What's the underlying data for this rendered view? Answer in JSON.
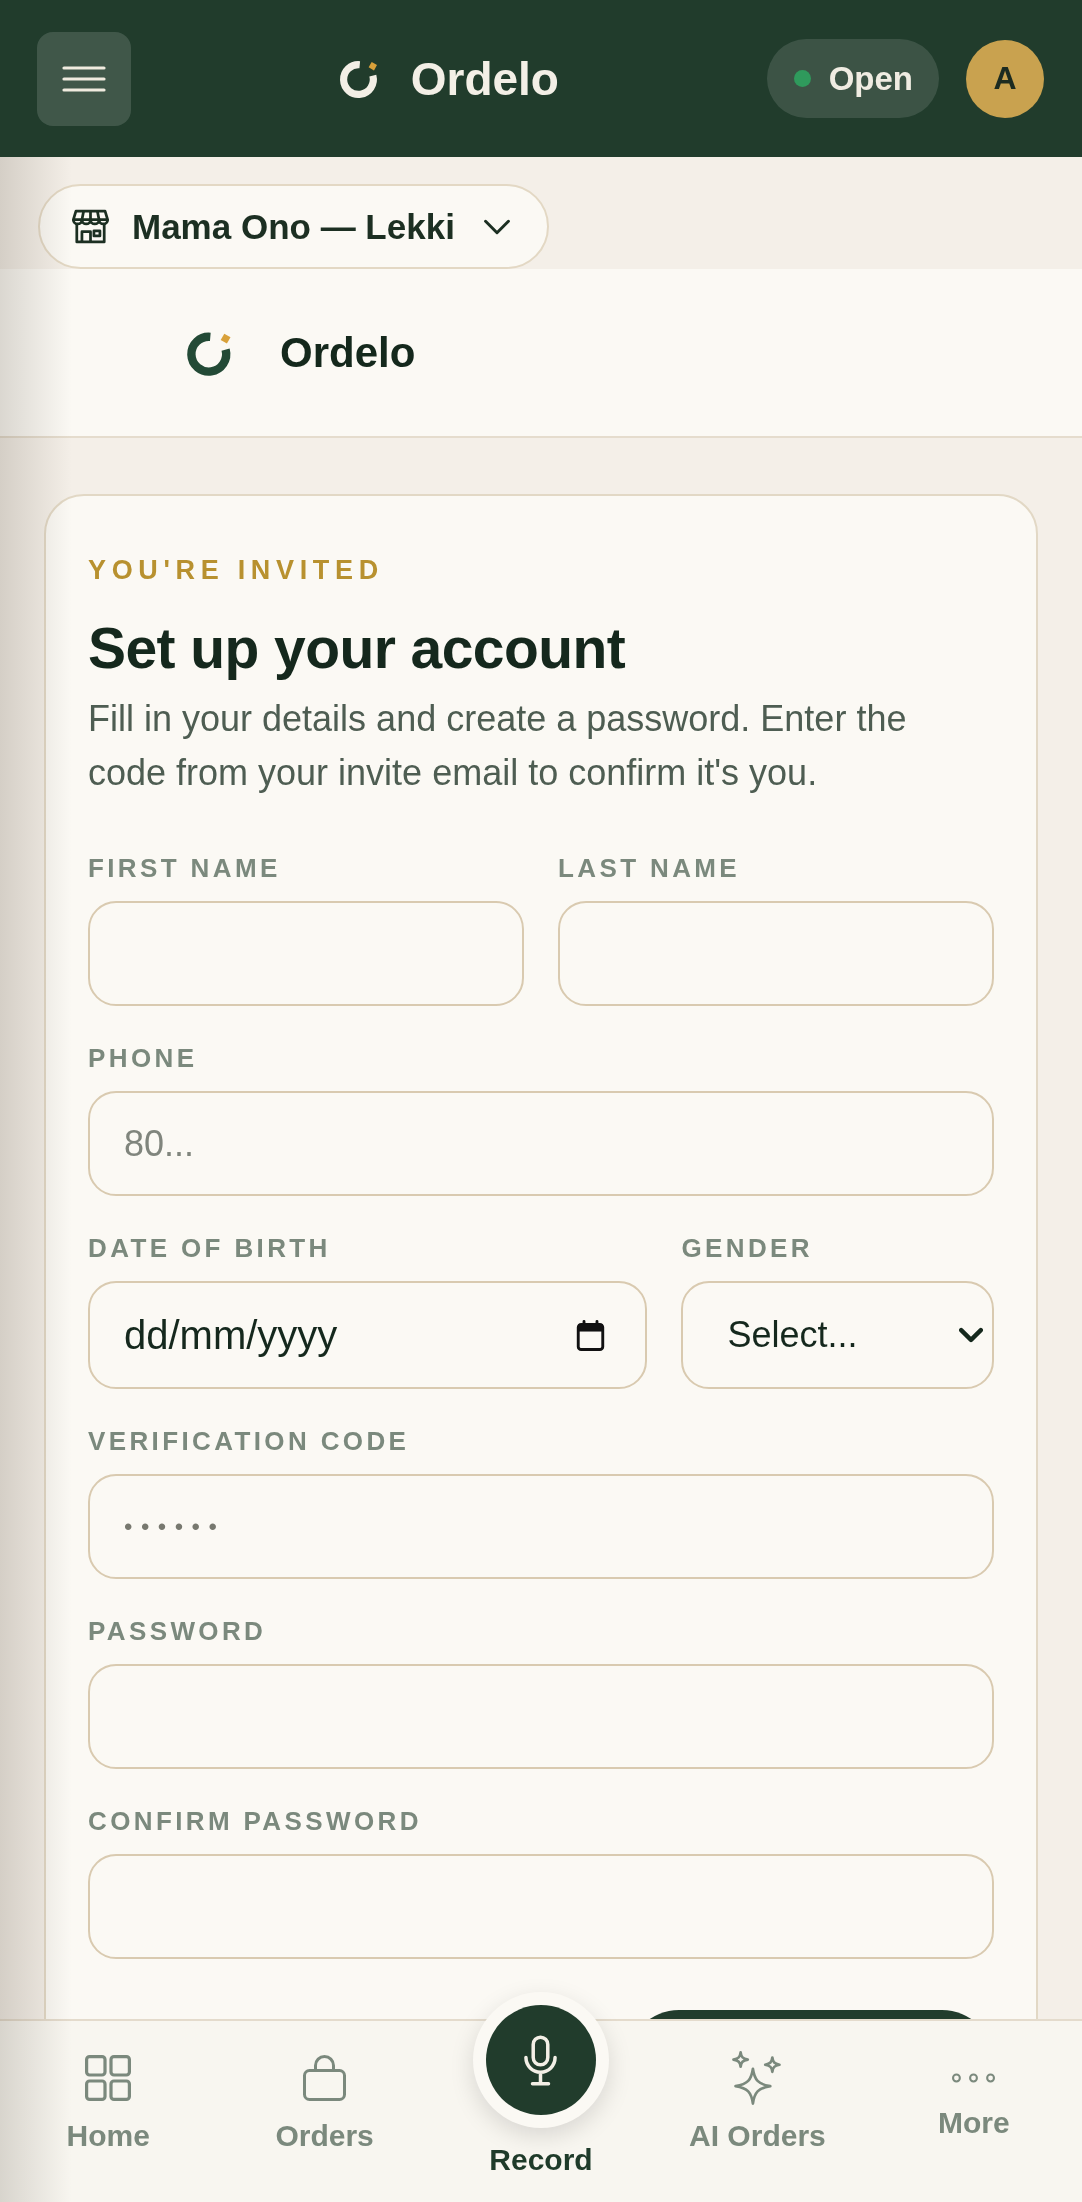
{
  "top_bar": {
    "brand": "Ordelo",
    "status": {
      "label": "Open",
      "on": true
    },
    "avatar": "A"
  },
  "store_switcher": {
    "label": "Mama Ono — Lekki"
  },
  "brand_banner": {
    "name": "Ordelo"
  },
  "invite_card": {
    "eyebrow": "YOU'RE INVITED",
    "title": "Set up your account",
    "description": "Fill in your details and create a password. Enter the code from your invite email to confirm it's you.",
    "rows": [
      {
        "fields": [
          {
            "kind": "text",
            "label": "FIRST NAME"
          },
          {
            "kind": "text",
            "label": "LAST NAME"
          }
        ]
      },
      {
        "fields": [
          {
            "kind": "phone",
            "label": "PHONE",
            "placeholder": "80..."
          }
        ]
      },
      {
        "fields": [
          {
            "kind": "date",
            "label": "DATE OF BIRTH",
            "placeholder": "dd/mm/yyyy"
          },
          {
            "kind": "select",
            "label": "GENDER",
            "value": "Select..."
          }
        ]
      },
      {
        "fields": [
          {
            "kind": "code",
            "label": "VERIFICATION CODE",
            "placeholder": "••••••"
          }
        ]
      },
      {
        "fields": [
          {
            "kind": "password",
            "label": "PASSWORD"
          }
        ]
      },
      {
        "fields": [
          {
            "kind": "password",
            "label": "CONFIRM PASSWORD"
          }
        ]
      }
    ]
  },
  "bottom_nav": {
    "items": [
      {
        "kind": "tab",
        "label": "Home"
      },
      {
        "kind": "tab",
        "label": "Orders"
      },
      {
        "kind": "fab",
        "label": "Record"
      },
      {
        "kind": "tab",
        "label": "AI Orders"
      },
      {
        "kind": "tab",
        "label": "More"
      }
    ]
  }
}
